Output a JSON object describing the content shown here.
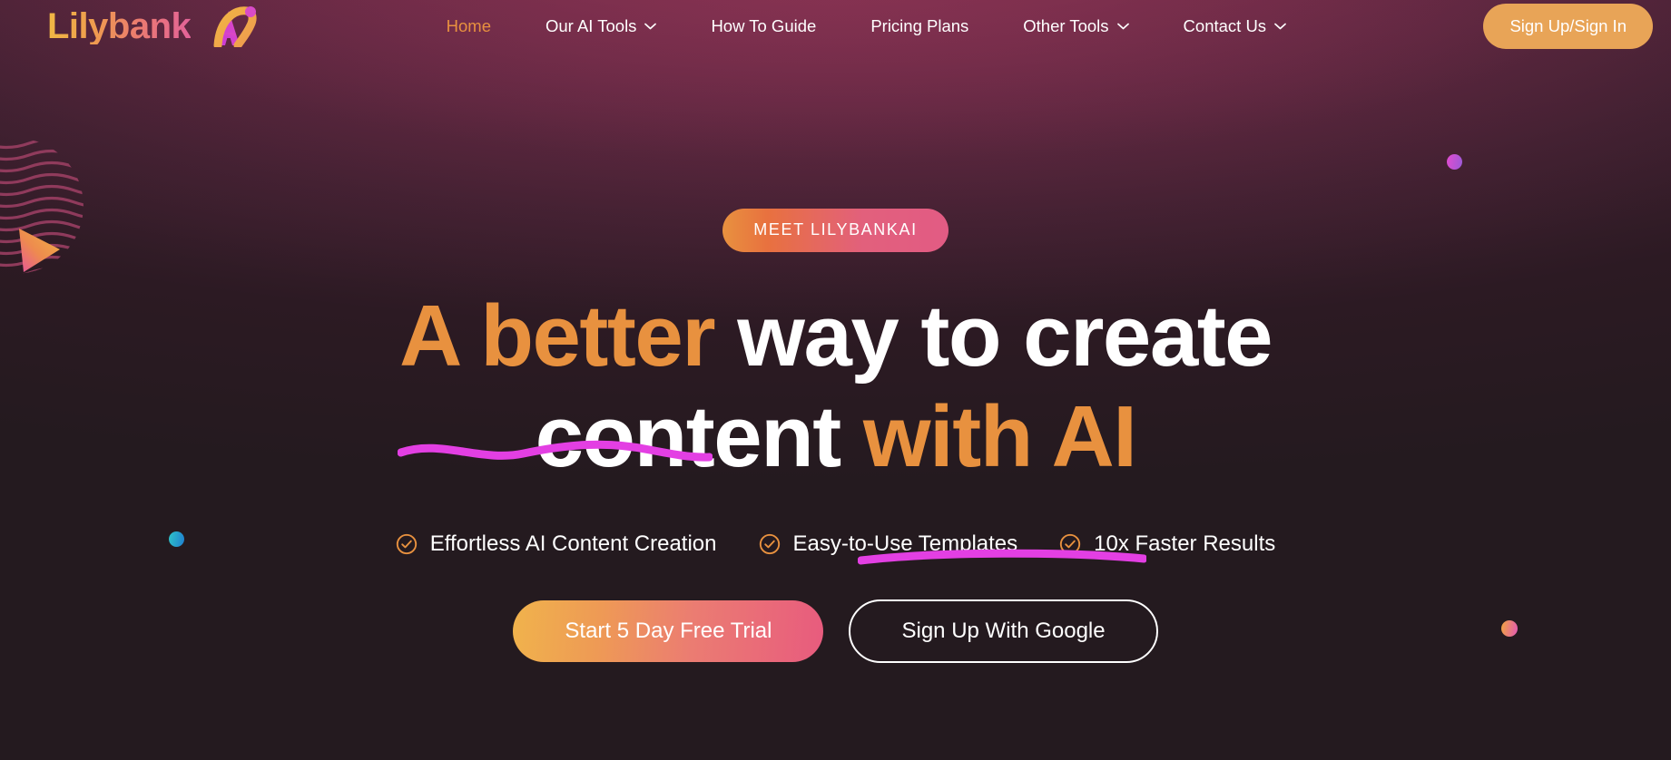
{
  "brand": {
    "logo_word": "Lilybank",
    "logo_suffix": "Ai"
  },
  "nav": {
    "items": [
      {
        "label": "Home",
        "active": true,
        "caret": false
      },
      {
        "label": "Our AI Tools",
        "active": false,
        "caret": true
      },
      {
        "label": "How To Guide",
        "active": false,
        "caret": false
      },
      {
        "label": "Pricing Plans",
        "active": false,
        "caret": false
      },
      {
        "label": "Other Tools",
        "active": false,
        "caret": true
      },
      {
        "label": "Contact Us",
        "active": false,
        "caret": true
      }
    ],
    "signup_label": "Sign Up/Sign In"
  },
  "hero": {
    "badge": "MEET LILYBANKAI",
    "headline_line1_accent": "A better",
    "headline_line1_rest": " way to create",
    "headline_line2_plain": "content ",
    "headline_line2_accent": "with AI",
    "features": [
      {
        "icon": "check-circle-icon",
        "label": "Effortless AI Content Creation"
      },
      {
        "icon": "check-circle-icon",
        "label": "Easy-to-Use Templates"
      },
      {
        "icon": "check-circle-icon",
        "label": "10x Faster Results"
      }
    ],
    "cta_primary": "Start 5 Day Free Trial",
    "cta_secondary": "Sign Up With Google"
  },
  "colors": {
    "background": "#241A1F",
    "background_glow": "#8E3355",
    "accent_orange": "#E8913F",
    "accent_magenta": "#E040E0",
    "accent_pink": "#E85B7E",
    "accent_yellow": "#F0B34C",
    "button_orange": "#E8A457",
    "text_white": "#FFFFFF",
    "dot_teal": "#2FC4C8",
    "dot_pink": "#E34BD0"
  },
  "decorations": [
    {
      "name": "wavy-circle",
      "color": "#8E3A5E"
    },
    {
      "name": "gradient-triangle",
      "color": "#F0A53E"
    },
    {
      "name": "teal-dot",
      "color": "#2FC4C8"
    },
    {
      "name": "pink-dot",
      "color": "#E34BD0"
    },
    {
      "name": "orange-dot",
      "color": "#F0A53E"
    }
  ]
}
